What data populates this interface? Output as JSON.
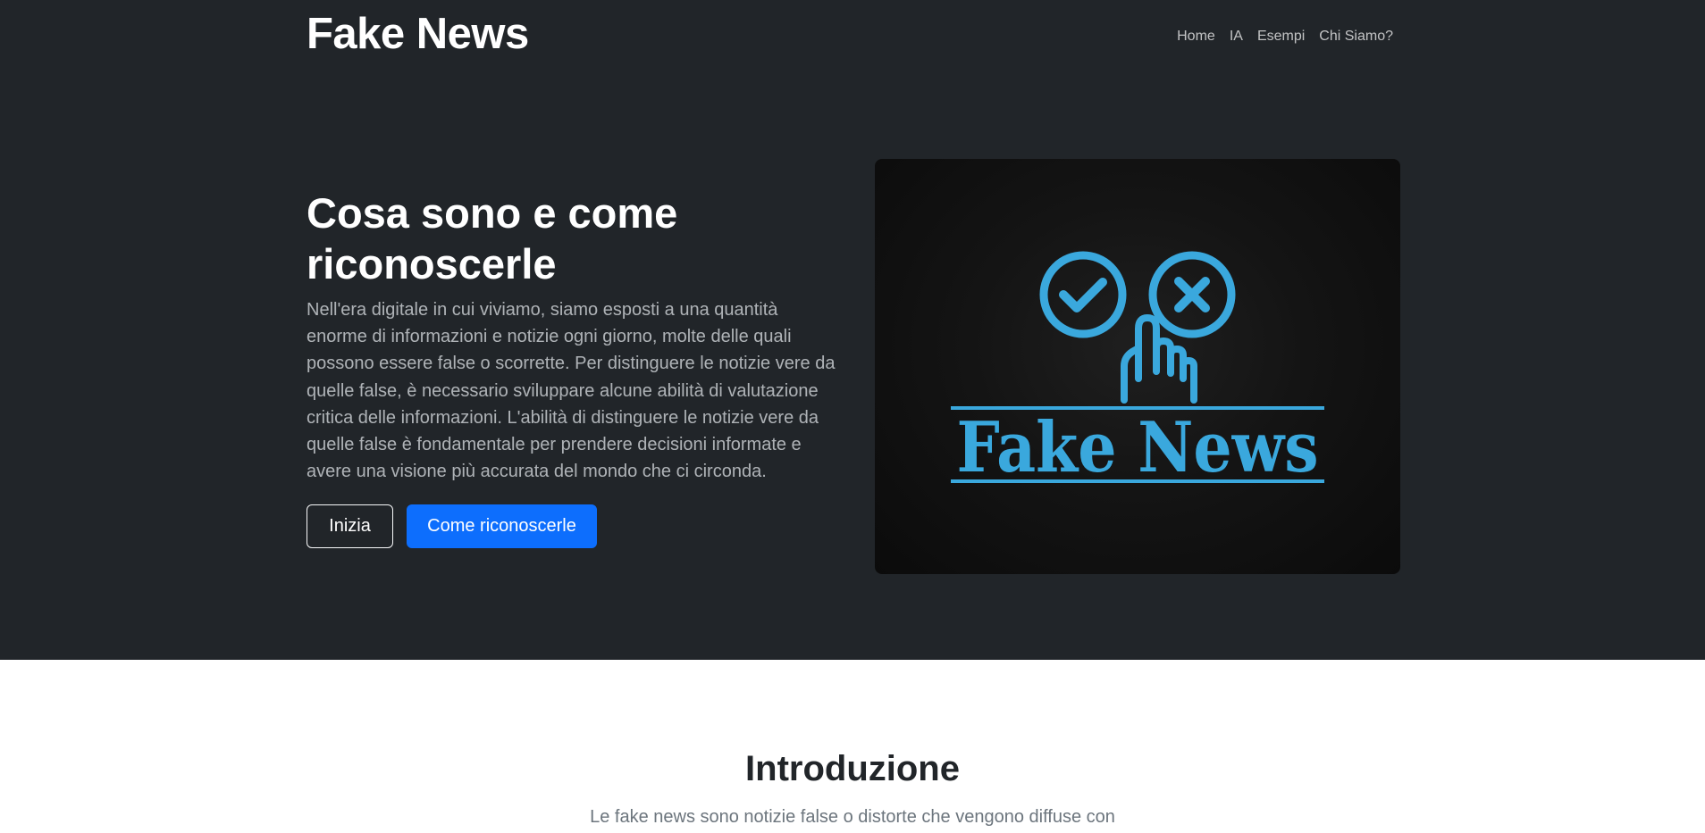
{
  "header": {
    "brand": "Fake News",
    "nav": [
      "Home",
      "IA",
      "Esempi",
      "Chi Siamo?"
    ]
  },
  "hero": {
    "title": "Cosa sono e come riconoscerle",
    "text": "Nell'era digitale in cui viviamo, siamo esposti a una quantità enorme di informazioni e notizie ogni giorno, molte delle quali possono essere false o scorrette. Per distinguere le notizie vere da quelle false, è necessario sviluppare alcune abilità di valutazione critica delle informazioni. L'abilità di distinguere le notizie vere da quelle false è fondamentale per prendere decisioni informate e avere una visione più accurata del mondo che ci circonda.",
    "button_start": "Inizia",
    "button_learn": "Come riconoscerle",
    "image_text": "Fake News"
  },
  "intro": {
    "title": "Introduzione",
    "text": "Le fake news sono notizie false o distorte che vengono diffuse con"
  },
  "colors": {
    "hero_bg": "#212529",
    "primary": "#0d6efd",
    "logo_blue": "#3aa8dd"
  }
}
